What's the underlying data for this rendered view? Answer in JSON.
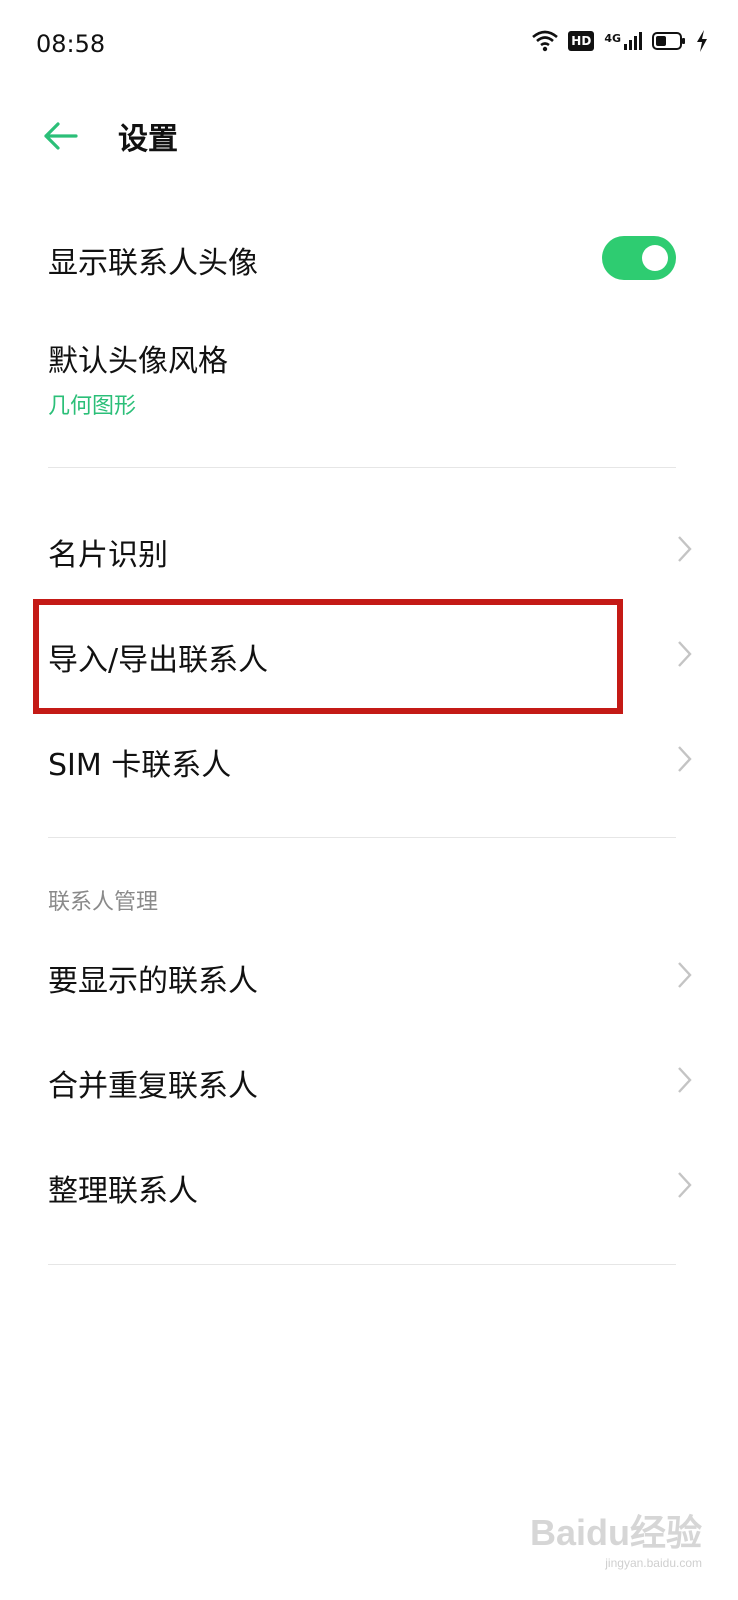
{
  "status_bar": {
    "time": "08:58",
    "hd_badge": "HD",
    "network": "4G",
    "icons": [
      "wifi-icon",
      "hd-icon",
      "signal-icon",
      "battery-icon",
      "charging-icon"
    ]
  },
  "header": {
    "title": "设置",
    "back_icon": "back-arrow-icon",
    "accent_color": "#2bbf78"
  },
  "settings": {
    "show_avatar": {
      "label": "显示联系人头像",
      "toggle_on": true
    },
    "avatar_style": {
      "label": "默认头像风格",
      "value": "几何图形"
    },
    "card_recognition": {
      "label": "名片识别"
    },
    "import_export": {
      "label": "导入/导出联系人",
      "highlighted": true
    },
    "sim_contacts": {
      "label": "SIM 卡联系人"
    }
  },
  "management": {
    "section_title": "联系人管理",
    "items": [
      {
        "label": "要显示的联系人"
      },
      {
        "label": "合并重复联系人"
      },
      {
        "label": "整理联系人"
      }
    ]
  },
  "watermark": {
    "text": "Baidu经验",
    "url": "jingyan.baidu.com"
  },
  "colors": {
    "toggle": "#2ecc71",
    "highlight_border": "#c41a16"
  }
}
